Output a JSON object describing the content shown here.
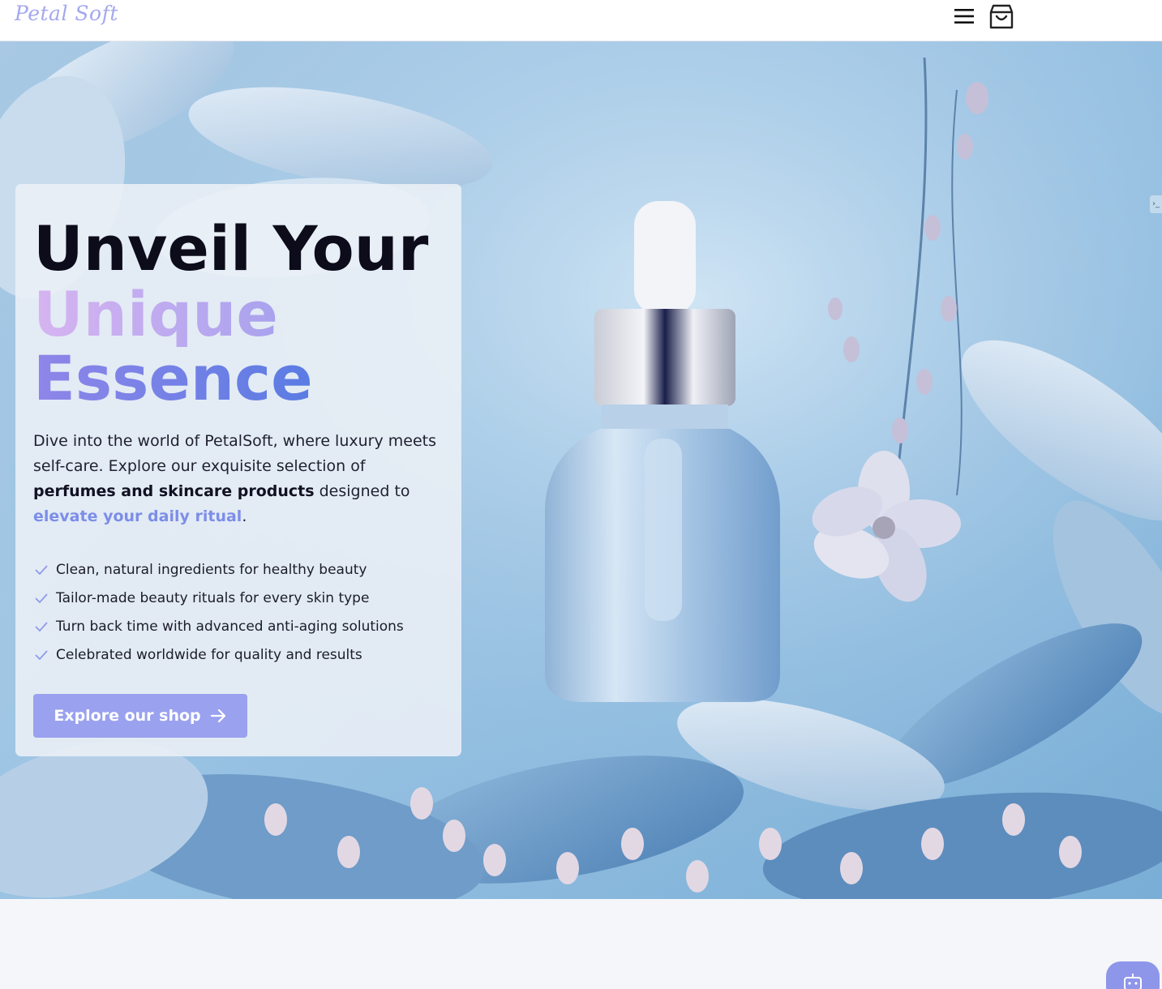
{
  "header": {
    "logo": "Petal Soft",
    "menu_icon": "hamburger-menu-icon",
    "cart_icon": "shopping-bag-icon"
  },
  "hero": {
    "headline_line1": "Unveil Your",
    "headline_line2": "Unique",
    "headline_line3": "Essence",
    "description": {
      "part1": "Dive into the world of PetalSoft, where luxury meets self-care. Explore our exquisite selection of ",
      "strong": "perfumes and skincare products",
      "part2": " designed to ",
      "accent": "elevate your daily ritual",
      "end": "."
    },
    "features": [
      "Clean, natural ingredients for healthy beauty",
      "Tailor-made beauty rituals for every skin type",
      "Turn back time with advanced anti-aging solutions",
      "Celebrated worldwide for quality and results"
    ],
    "cta_label": "Explore our shop",
    "side_tab_label": "›_"
  },
  "chat_button_icon": "robot-icon",
  "colors": {
    "accent": "#9aa1ef",
    "gradient_start": "#d7b4f1",
    "gradient_end": "#5a7ce3",
    "logo": "#a4a8ee"
  }
}
